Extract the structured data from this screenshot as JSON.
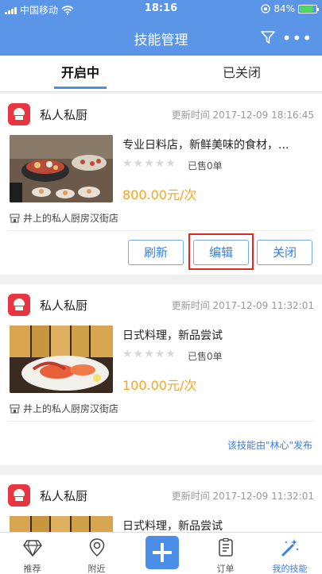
{
  "status_bar": {
    "carrier": "中国移动",
    "time": "18:16",
    "battery": "84%",
    "battery_level": 0.84
  },
  "navbar": {
    "title": "技能管理",
    "more": "•••"
  },
  "tabs": [
    {
      "label": "开启中",
      "active": true
    },
    {
      "label": "已关闭",
      "active": false
    }
  ],
  "cards": [
    {
      "shop": "私人私厨",
      "updated": "更新时间 2017-12-09 18:16:45",
      "title": "专业日料店，新鲜美味的食材，...",
      "stars": "★★★★★",
      "sold": "已售0单",
      "price": "800.00元/次",
      "address": "井上的私人厨房汉街店",
      "buttons": {
        "refresh": "刷新",
        "edit": "编辑",
        "close": "关闭"
      }
    },
    {
      "shop": "私人私厨",
      "updated": "更新时间 2017-12-09 11:32:01",
      "title": "日式料理，新品尝试",
      "stars": "★★★★★",
      "sold": "已售0单",
      "price": "100.00元/次",
      "address": "井上的私人厨房汉街店",
      "publisher": "该技能由\"林心\"发布"
    },
    {
      "shop": "私人私厨",
      "updated": "更新时间 2017-12-09 11:32:01",
      "title": "日式料理，新品尝试"
    }
  ],
  "tabbar": [
    {
      "label": "推荐",
      "icon": "diamond-icon"
    },
    {
      "label": "附近",
      "icon": "location-pin-icon"
    },
    {
      "label": "",
      "icon": "plus-icon"
    },
    {
      "label": "订单",
      "icon": "order-list-icon"
    },
    {
      "label": "我的技能",
      "icon": "magic-wand-icon",
      "active": true
    }
  ],
  "colors": {
    "header": "#5b95e8",
    "accent": "#3b7fe0",
    "price": "#f5a623",
    "logo": "#e9353f",
    "highlight": "#e02828"
  }
}
